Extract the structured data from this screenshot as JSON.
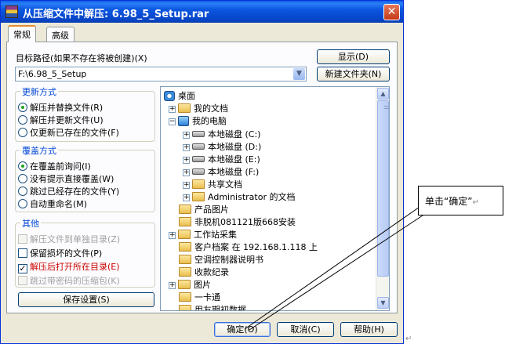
{
  "window": {
    "title": "从压缩文件中解压: 6.98_5_Setup.rar",
    "close_label": "✕"
  },
  "tabs": [
    {
      "label": "常规",
      "active": true
    },
    {
      "label": "高级",
      "active": false
    }
  ],
  "destination": {
    "label": "目标路径(如果不存在将被创建)(X)",
    "value": "F:\\6.98_5_Setup",
    "show_button": "显示(D)",
    "new_folder_button": "新建文件夹(N)"
  },
  "update_mode": {
    "title": "更新方式",
    "options": [
      {
        "label": "解压并替换文件(R)",
        "selected": true
      },
      {
        "label": "解压并更新文件(U)",
        "selected": false
      },
      {
        "label": "仅更新已存在的文件(F)",
        "selected": false
      }
    ]
  },
  "overwrite_mode": {
    "title": "覆盖方式",
    "options": [
      {
        "label": "在覆盖前询问(I)",
        "selected": true
      },
      {
        "label": "没有提示直接覆盖(W)",
        "selected": false
      },
      {
        "label": "跳过已经存在的文件(Y)",
        "selected": false
      },
      {
        "label": "自动重命名(M)",
        "selected": false
      }
    ]
  },
  "misc": {
    "title": "其他",
    "options": [
      {
        "label": "解压文件到单独目录(Z)",
        "checked": false,
        "enabled": false
      },
      {
        "label": "保留损坏的文件(P)",
        "checked": false,
        "enabled": true
      },
      {
        "label": "解压后打开所在目录(E)",
        "checked": true,
        "enabled": true
      },
      {
        "label": "跳过带密码的压缩包(K)",
        "checked": false,
        "enabled": false
      }
    ]
  },
  "save_settings_button": "保存设置(S)",
  "tree": [
    {
      "label": "桌面",
      "icon": "desktop-icon"
    },
    {
      "label": "我的文档",
      "icon": "folder-icon"
    },
    {
      "label": "我的电脑",
      "icon": "computer-icon"
    },
    {
      "label": "本地磁盘 (C:)",
      "icon": "drive-icon"
    },
    {
      "label": "本地磁盘 (D:)",
      "icon": "drive-icon"
    },
    {
      "label": "本地磁盘 (E:)",
      "icon": "drive-icon"
    },
    {
      "label": "本地磁盘 (F:)",
      "icon": "drive-icon"
    },
    {
      "label": "共享文档",
      "icon": "folder-icon"
    },
    {
      "label": "Administrator 的文档",
      "icon": "folder-icon"
    },
    {
      "label": "产品图片",
      "icon": "folder-icon"
    },
    {
      "label": "非脱机081121版668安装",
      "icon": "folder-icon"
    },
    {
      "label": "工作站采集",
      "icon": "folder-icon"
    },
    {
      "label": "客户档案 在 192.168.1.118 上",
      "icon": "folder-icon"
    },
    {
      "label": "空调控制器说明书",
      "icon": "folder-icon"
    },
    {
      "label": "收款纪录",
      "icon": "folder-icon"
    },
    {
      "label": "图片",
      "icon": "folder-icon"
    },
    {
      "label": "一卡通",
      "icon": "folder-icon"
    },
    {
      "label": "用友期初数据",
      "icon": "folder-icon"
    }
  ],
  "footer": {
    "ok": "确定(O)",
    "cancel": "取消(C)",
    "help": "帮助(H)"
  },
  "callout": {
    "text": "单击“确定”",
    "mark": "↵"
  },
  "colors": {
    "titlebar": "#0b56e0",
    "group_title": "#0046d5",
    "highlight_text": "#cc0000"
  }
}
